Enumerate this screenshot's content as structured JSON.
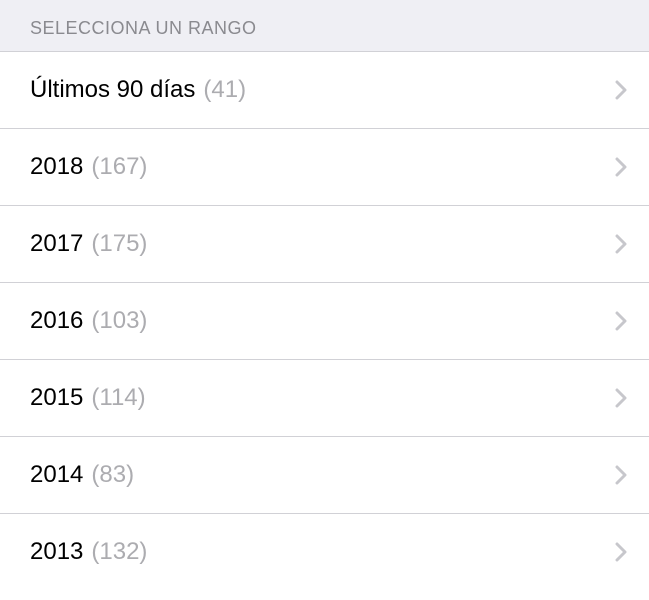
{
  "section_header": "Selecciona un rango",
  "items": [
    {
      "label": "Últimos 90 días",
      "count": "(41)"
    },
    {
      "label": "2018",
      "count": "(167)"
    },
    {
      "label": "2017",
      "count": "(175)"
    },
    {
      "label": "2016",
      "count": "(103)"
    },
    {
      "label": "2015",
      "count": "(114)"
    },
    {
      "label": "2014",
      "count": "(83)"
    },
    {
      "label": "2013",
      "count": "(132)"
    }
  ]
}
